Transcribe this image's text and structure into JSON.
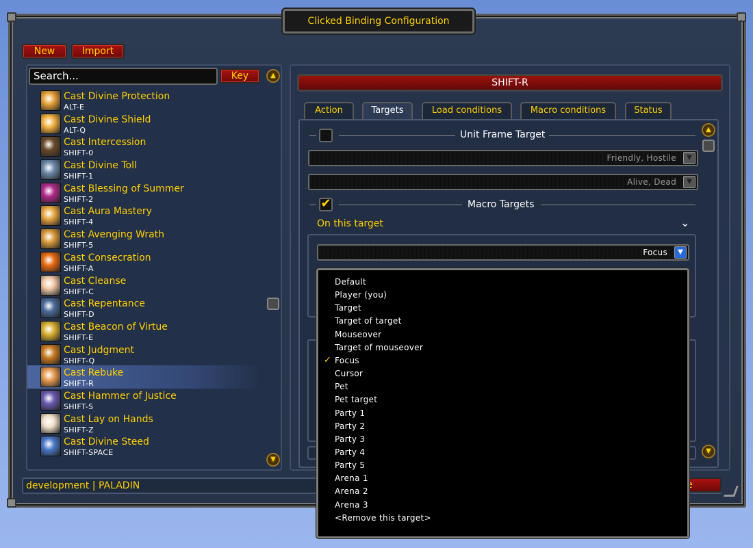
{
  "window": {
    "title": "Clicked Binding Configuration"
  },
  "toolbar": {
    "new_label": "New",
    "import_label": "Import"
  },
  "search": {
    "placeholder": "Search...",
    "key_label": "Key"
  },
  "bindings": [
    {
      "name": "Cast Divine Protection",
      "key": "ALT-E",
      "icon": "divine-protection-icon",
      "color": "#e8a23a"
    },
    {
      "name": "Cast Divine Shield",
      "key": "ALT-Q",
      "icon": "divine-shield-icon",
      "color": "#f0b040"
    },
    {
      "name": "Cast Intercession",
      "key": "SHIFT-0",
      "icon": "intercession-icon",
      "color": "#6a4a2a"
    },
    {
      "name": "Cast Divine Toll",
      "key": "SHIFT-1",
      "icon": "divine-toll-icon",
      "color": "#6a8aa8"
    },
    {
      "name": "Cast Blessing of Summer",
      "key": "SHIFT-2",
      "icon": "blessing-of-summer-icon",
      "color": "#b02a8a"
    },
    {
      "name": "Cast Aura Mastery",
      "key": "SHIFT-4",
      "icon": "aura-mastery-icon",
      "color": "#e8a840"
    },
    {
      "name": "Cast Avenging Wrath",
      "key": "SHIFT-5",
      "icon": "avenging-wrath-icon",
      "color": "#d89a3a"
    },
    {
      "name": "Cast Consecration",
      "key": "SHIFT-A",
      "icon": "consecration-icon",
      "color": "#e86a10"
    },
    {
      "name": "Cast Cleanse",
      "key": "SHIFT-C",
      "icon": "cleanse-icon",
      "color": "#f0c8a8"
    },
    {
      "name": "Cast Repentance",
      "key": "SHIFT-D",
      "icon": "repentance-icon",
      "color": "#4a6a9a"
    },
    {
      "name": "Cast Beacon of Virtue",
      "key": "SHIFT-E",
      "icon": "beacon-of-virtue-icon",
      "color": "#d8b030"
    },
    {
      "name": "Cast Judgment",
      "key": "SHIFT-Q",
      "icon": "judgment-icon",
      "color": "#c87a20"
    },
    {
      "name": "Cast Rebuke",
      "key": "SHIFT-R",
      "icon": "rebuke-icon",
      "color": "#e89a50"
    },
    {
      "name": "Cast Hammer of Justice",
      "key": "SHIFT-S",
      "icon": "hammer-of-justice-icon",
      "color": "#6a5ab0"
    },
    {
      "name": "Cast Lay on Hands",
      "key": "SHIFT-Z",
      "icon": "lay-on-hands-icon",
      "color": "#f0e0c8"
    },
    {
      "name": "Cast Divine Steed",
      "key": "SHIFT-SPACE",
      "icon": "divine-steed-icon",
      "color": "#4a78c8"
    }
  ],
  "selected_binding": "SHIFT-R",
  "status": "development | PALADIN",
  "detail": {
    "key_title": "SHIFT-R",
    "tabs": [
      "Action",
      "Targets",
      "Load conditions",
      "Macro conditions",
      "Status"
    ],
    "active_tab": "Targets",
    "unit_frame_target": {
      "label": "Unit Frame Target",
      "checked": false,
      "hostility": "Friendly, Hostile",
      "vitals": "Alive, Dead"
    },
    "macro_targets": {
      "label": "Macro Targets",
      "checked": true,
      "section_label": "On this target",
      "target_value": "Focus"
    },
    "close_label": "se"
  },
  "target_menu": {
    "items": [
      "Default",
      "Player (you)",
      "Target",
      "Target of target",
      "Mouseover",
      "Target of mouseover",
      "Focus",
      "Cursor",
      "Pet",
      "Pet target",
      "Party 1",
      "Party 2",
      "Party 3",
      "Party 4",
      "Party 5",
      "Arena 1",
      "Arena 2",
      "Arena 3",
      "<Remove this target>"
    ],
    "selected": "Focus"
  }
}
